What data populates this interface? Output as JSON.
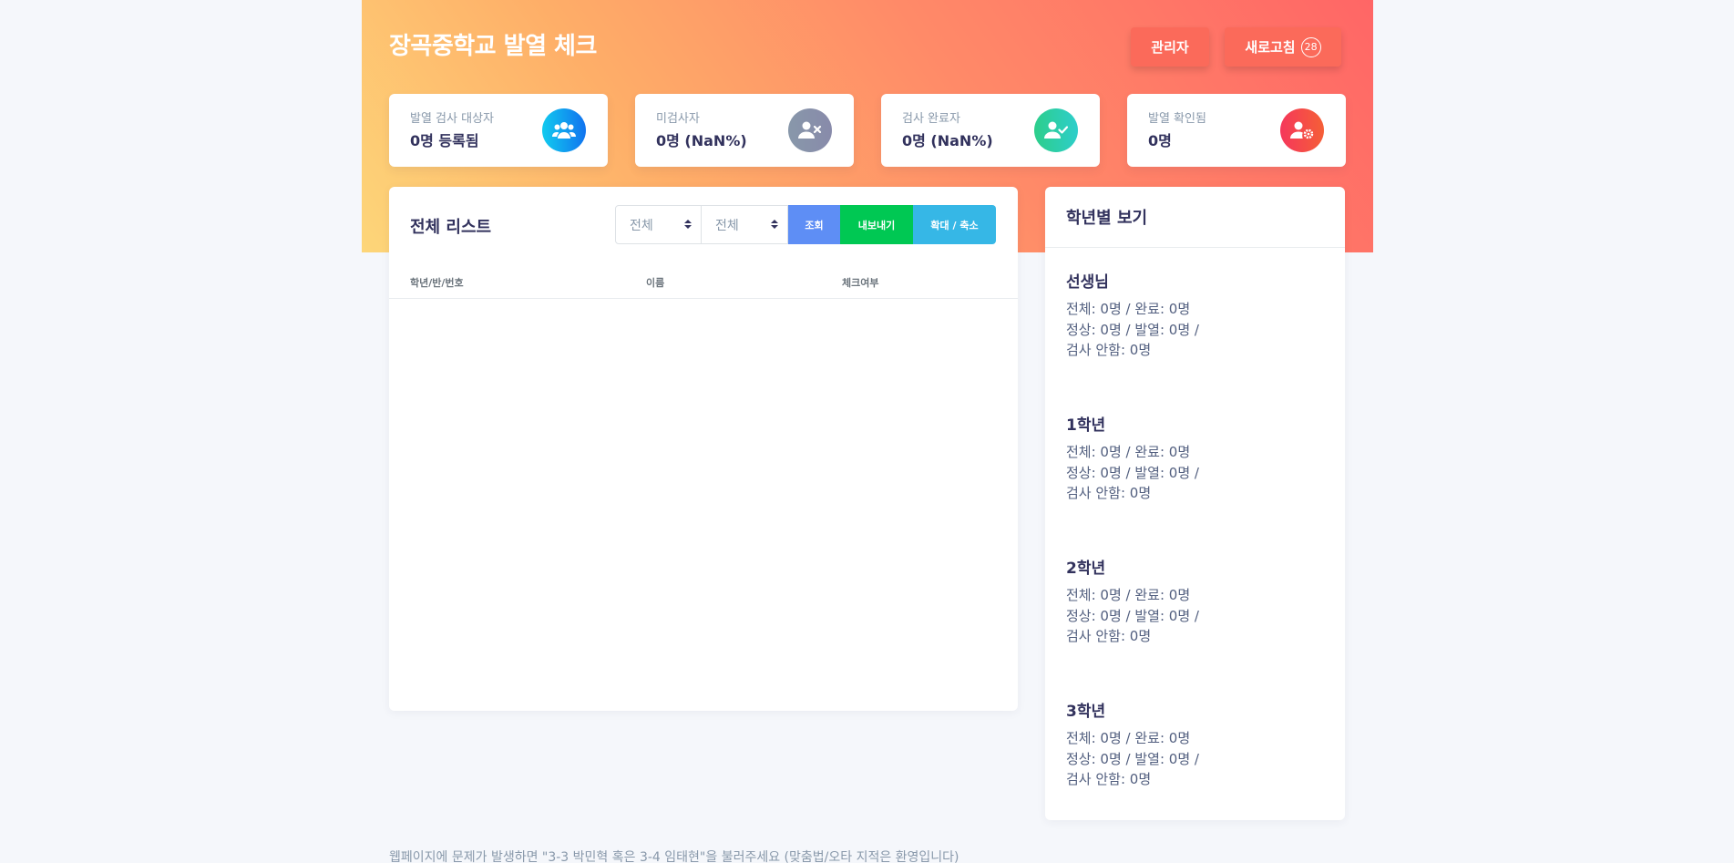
{
  "header": {
    "title": "장곡중학교 발열 체크",
    "admin_label": "관리자",
    "refresh_label": "새로고침",
    "refresh_count": "28"
  },
  "stats": [
    {
      "label": "발열 검사 대상자",
      "value": "0명 등록됨",
      "icon": "users-icon",
      "color": "#11cdef"
    },
    {
      "label": "미검사자",
      "value": "0명 (NaN%)",
      "icon": "user-times-icon",
      "color": "#8898aa"
    },
    {
      "label": "검사 완료자",
      "value": "0명 (NaN%)",
      "icon": "user-check-icon",
      "color": "#2dce89"
    },
    {
      "label": "발열 확인됨",
      "value": "0명",
      "icon": "user-cog-icon",
      "color": "#f5365c"
    }
  ],
  "list": {
    "title": "전체 리스트",
    "filter1": "전체",
    "filter2": "전체",
    "search_label": "조회",
    "export_label": "내보내기",
    "zoom_label": "확대 / 축소",
    "columns": [
      "학년/반/번호",
      "이름",
      "체크여부"
    ]
  },
  "grades": {
    "title": "학년별 보기",
    "items": [
      {
        "name": "선생님",
        "line1": "전체: 0명 / 완료: 0명",
        "line2": "정상: 0명 / 발열: 0명 /",
        "line3": "검사 안함: 0명"
      },
      {
        "name": "1학년",
        "line1": "전체: 0명 / 완료: 0명",
        "line2": "정상: 0명 / 발열: 0명 /",
        "line3": "검사 안함: 0명"
      },
      {
        "name": "2학년",
        "line1": "전체: 0명 / 완료: 0명",
        "line2": "정상: 0명 / 발열: 0명 /",
        "line3": "검사 안함: 0명"
      },
      {
        "name": "3학년",
        "line1": "전체: 0명 / 완료: 0명",
        "line2": "정상: 0명 / 발열: 0명 /",
        "line3": "검사 안함: 0명"
      }
    ]
  },
  "footer": {
    "text": "웹페이지에 문제가 발생하면 \"3-3 박민혁 혹은 3-4 임태현\"을 불러주세요 (맞춤법/오타 지적은 환영입니다)"
  }
}
